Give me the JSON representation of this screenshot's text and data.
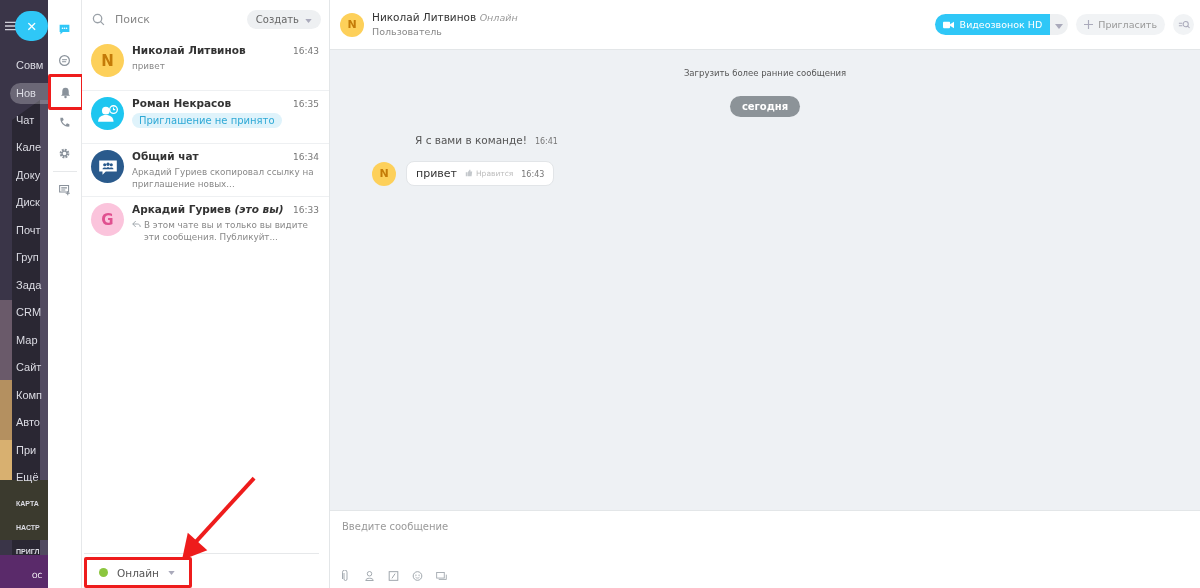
{
  "sidebar": {
    "close": "×",
    "items": [
      {
        "label": "Совм",
        "selected": false,
        "kind": "item"
      },
      {
        "label": "Нов",
        "selected": true,
        "kind": "item"
      },
      {
        "label": "Чат",
        "selected": false,
        "kind": "item"
      },
      {
        "label": "Кале",
        "selected": false,
        "kind": "item"
      },
      {
        "label": "Доку",
        "selected": false,
        "kind": "item"
      },
      {
        "label": "Диск",
        "selected": false,
        "kind": "item"
      },
      {
        "label": "Почт",
        "selected": false,
        "kind": "item"
      },
      {
        "label": "Груп",
        "selected": false,
        "kind": "item"
      },
      {
        "label": "Зада",
        "selected": false,
        "kind": "item"
      },
      {
        "label": "CRM",
        "selected": false,
        "kind": "item"
      },
      {
        "label": "Мар",
        "selected": false,
        "kind": "item"
      },
      {
        "label": "Сайт",
        "selected": false,
        "kind": "item"
      },
      {
        "label": "Комп",
        "selected": false,
        "kind": "item"
      },
      {
        "label": "Авто",
        "selected": false,
        "kind": "item"
      },
      {
        "label": "При",
        "selected": false,
        "kind": "item"
      },
      {
        "label": "Ещё",
        "selected": false,
        "kind": "item"
      },
      {
        "label": "КАРТА",
        "selected": false,
        "kind": "caps"
      },
      {
        "label": "НАСТР",
        "selected": false,
        "kind": "caps"
      },
      {
        "label": "ПРИГЛ",
        "selected": false,
        "kind": "caps"
      }
    ],
    "user": "ОС"
  },
  "rail": [
    {
      "kind": "chats",
      "selected": true,
      "highlighted": false
    },
    {
      "kind": "openlines",
      "selected": false,
      "highlighted": false
    },
    {
      "kind": "notifications",
      "selected": false,
      "highlighted": true
    },
    {
      "kind": "calls",
      "selected": false,
      "highlighted": false
    },
    {
      "kind": "settings",
      "selected": false,
      "highlighted": false
    },
    {
      "kind": "new-chat",
      "selected": false,
      "highlighted": false
    }
  ],
  "chat_list": {
    "search": {
      "placeholder": "Поиск"
    },
    "create_button": "Создать",
    "chats": [
      {
        "name": "Николай Литвинов",
        "time": "16:43",
        "preview": "привет",
        "avatar": {
          "kind": "letter",
          "letter": "N",
          "color": "#fdd05a"
        }
      },
      {
        "name": "Роман Некрасов",
        "time": "16:35",
        "invite_status": "Приглашение не принято",
        "avatar": {
          "kind": "user",
          "color": "#1ec6f0"
        }
      },
      {
        "name": "Общий чат",
        "time": "16:34",
        "preview": "Аркадий Гуриев скопировал ссылку на приглашение новых...",
        "avatar": {
          "kind": "group",
          "color": "#2a5a8c"
        }
      },
      {
        "name": "Аркадий Гуриев *(это вы)*",
        "time": "16:33",
        "preview": "В этом чате вы и только вы видите эти сообщения. Публикуйт...",
        "avatar": {
          "kind": "letter",
          "letter": "G",
          "color": "#fbc4dc"
        },
        "replied": true
      }
    ],
    "status": {
      "label": "Онлайн",
      "color": "#8cc63f",
      "highlighted": true
    }
  },
  "conversation": {
    "name": "Николай Литвинов",
    "presence": "Онлайн",
    "role": "Пользователь",
    "avatar": {
      "letter": "N",
      "color": "#fdd05a"
    },
    "video_button": "Видеозвонок HD",
    "invite_button": "Пригласить",
    "load_more": "Загрузить более ранние сообщения",
    "date": "сегодня",
    "messages": [
      {
        "kind": "system",
        "text": "Я с вами в команде!",
        "time": "16:41"
      },
      {
        "kind": "message",
        "text": "привет",
        "like": "Нравится",
        "time": "16:43",
        "avatar": {
          "letter": "N",
          "color": "#fdd05a"
        }
      }
    ],
    "input": {
      "placeholder": "Введите сообщение"
    }
  }
}
